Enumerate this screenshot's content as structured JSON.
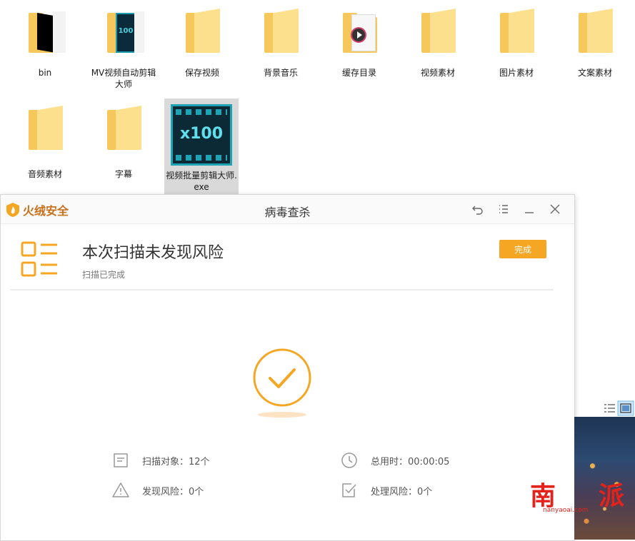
{
  "files": [
    {
      "label": "bin"
    },
    {
      "label": "MV视频自动剪辑大师"
    },
    {
      "label": "保存视频"
    },
    {
      "label": "背景音乐"
    },
    {
      "label": "缓存目录"
    },
    {
      "label": "视频素材"
    },
    {
      "label": "图片素材"
    },
    {
      "label": "文案素材"
    },
    {
      "label": "音频素材"
    },
    {
      "label": "字幕"
    },
    {
      "label": "视频批量剪辑大师.exe"
    }
  ],
  "app_icon_text": "x100",
  "mv_icon_text": "100",
  "dialog": {
    "brand": "火绒安全",
    "title": "病毒查杀",
    "result_title": "本次扫描未发现风险",
    "result_sub": "扫描已完成",
    "done_label": "完成",
    "stats": {
      "scan_objects": "扫描对象：12个",
      "total_time": "总用时：00:00:05",
      "risks_found": "发现风险：0个",
      "risks_handled": "处理风险：0个"
    }
  },
  "watermark": {
    "chars": [
      "南",
      "",
      "派"
    ],
    "sub": "nanyaoai.com"
  },
  "colors": {
    "accent": "#f5a623",
    "folder": "#f6c85c",
    "brand": "#c9701b",
    "watermark": "#e3221c"
  }
}
